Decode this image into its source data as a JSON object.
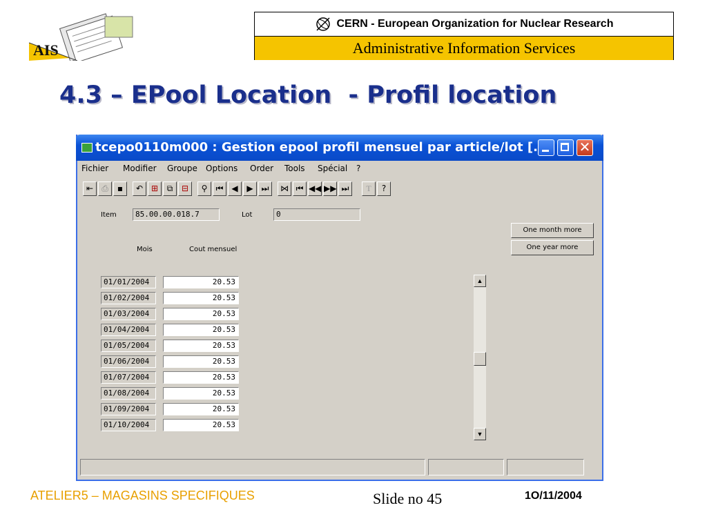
{
  "header": {
    "logo_text": "AIS",
    "banner_top": "CERN - European Organization for Nuclear Research",
    "banner_bottom": "Administrative Information Services"
  },
  "slide": {
    "title": "4.3 – EPool Location  - Profil location"
  },
  "window": {
    "title": "tcepo0110m000 : Gestion epool profil mensuel par article/lot [..."
  },
  "menu": [
    {
      "label": "Fichier"
    },
    {
      "label": "Modifier"
    },
    {
      "label": "Groupe"
    },
    {
      "label": "Options"
    },
    {
      "label": "Order"
    },
    {
      "label": "Tools"
    },
    {
      "label": "Spécial"
    },
    {
      "label": "?"
    }
  ],
  "toolbar_icons": [
    "exit-icon",
    "print-icon",
    "save-icon",
    "undo-icon",
    "insert-icon",
    "copy-icon",
    "delete-icon",
    "find-icon",
    "first-record-icon",
    "prev-record-icon",
    "next-record-icon",
    "last-record-icon",
    "first-group-icon",
    "prev-group-icon",
    "fast-back-icon",
    "fast-forward-icon",
    "last-group-icon",
    "text-icon",
    "help-icon"
  ],
  "form": {
    "item_label": "Item",
    "item_value": "85.00.00.018.7",
    "lot_label": "Lot",
    "lot_value": "0",
    "col_month": "Mois",
    "col_cost": "Cout mensuel",
    "one_month_more": "One month more",
    "one_year_more": "One year more",
    "rows": [
      {
        "month": "01/01/2004",
        "cost": "20.53"
      },
      {
        "month": "01/02/2004",
        "cost": "20.53"
      },
      {
        "month": "01/03/2004",
        "cost": "20.53"
      },
      {
        "month": "01/04/2004",
        "cost": "20.53"
      },
      {
        "month": "01/05/2004",
        "cost": "20.53"
      },
      {
        "month": "01/06/2004",
        "cost": "20.53"
      },
      {
        "month": "01/07/2004",
        "cost": "20.53"
      },
      {
        "month": "01/08/2004",
        "cost": "20.53"
      },
      {
        "month": "01/09/2004",
        "cost": "20.53"
      },
      {
        "month": "01/10/2004",
        "cost": "20.53"
      }
    ]
  },
  "footer": {
    "left": "ATELIER5 – MAGASINS SPECIFIQUES",
    "middle": "Slide no 45",
    "right": "1O/11/2004"
  },
  "colors": {
    "title_blue": "#1a2f8c",
    "banner_yellow": "#f5c400",
    "footer_orange": "#e8a000",
    "xp_blue": "#0a52d6"
  }
}
